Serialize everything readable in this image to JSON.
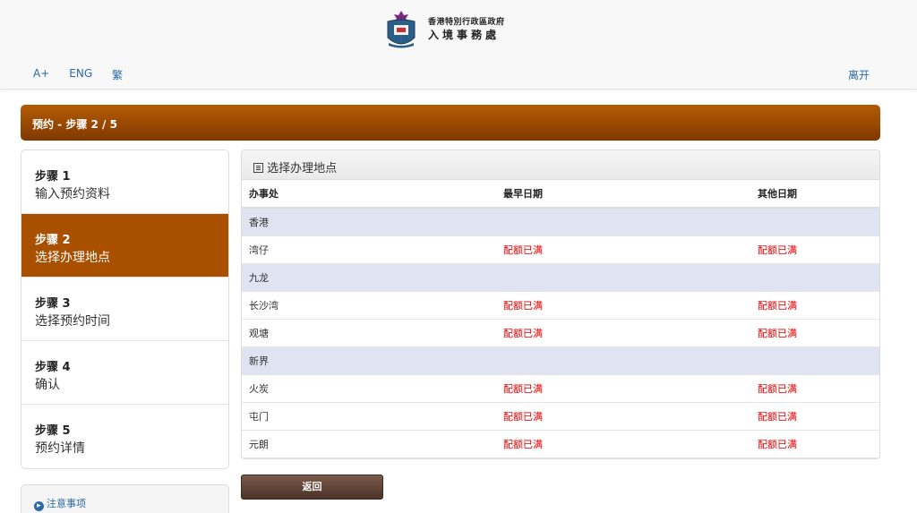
{
  "header": {
    "gov_name": "香港特別行政區政府",
    "dept_name": "入境事務處",
    "font_size_label": "A+",
    "lang_en": "ENG",
    "lang_tc": "繁",
    "exit_label": "离开"
  },
  "banner": {
    "title": "预约 - 步骤 2 / 5"
  },
  "steps": [
    {
      "num": "步骤 1",
      "label": "输入预约资料",
      "active": false
    },
    {
      "num": "步骤 2",
      "label": "选择办理地点",
      "active": true
    },
    {
      "num": "步骤 3",
      "label": "选择预约时间",
      "active": false
    },
    {
      "num": "步骤 4",
      "label": "确认",
      "active": false
    },
    {
      "num": "步骤 5",
      "label": "预约详情",
      "active": false
    }
  ],
  "notes": {
    "label": "注意事项"
  },
  "panel": {
    "title": "选择办理地点",
    "columns": [
      "办事处",
      "最早日期",
      "其他日期"
    ],
    "rows": [
      {
        "type": "region",
        "name": "香港"
      },
      {
        "type": "office",
        "name": "湾仔",
        "earliest": "配额已满",
        "other": "配额已满"
      },
      {
        "type": "region",
        "name": "九龙"
      },
      {
        "type": "office",
        "name": "长沙湾",
        "earliest": "配额已满",
        "other": "配额已满"
      },
      {
        "type": "office",
        "name": "观塘",
        "earliest": "配额已满",
        "other": "配额已满"
      },
      {
        "type": "region",
        "name": "新界"
      },
      {
        "type": "office",
        "name": "火炭",
        "earliest": "配额已满",
        "other": "配额已满"
      },
      {
        "type": "office",
        "name": "屯门",
        "earliest": "配额已满",
        "other": "配额已满"
      },
      {
        "type": "office",
        "name": "元朗",
        "earliest": "配额已满",
        "other": "配额已满"
      }
    ]
  },
  "buttons": {
    "back": "返回"
  },
  "colors": {
    "accent": "#a85000",
    "link": "#2a6aa4",
    "full_quota": "#e00000",
    "region_row": "#dfe3f2"
  }
}
